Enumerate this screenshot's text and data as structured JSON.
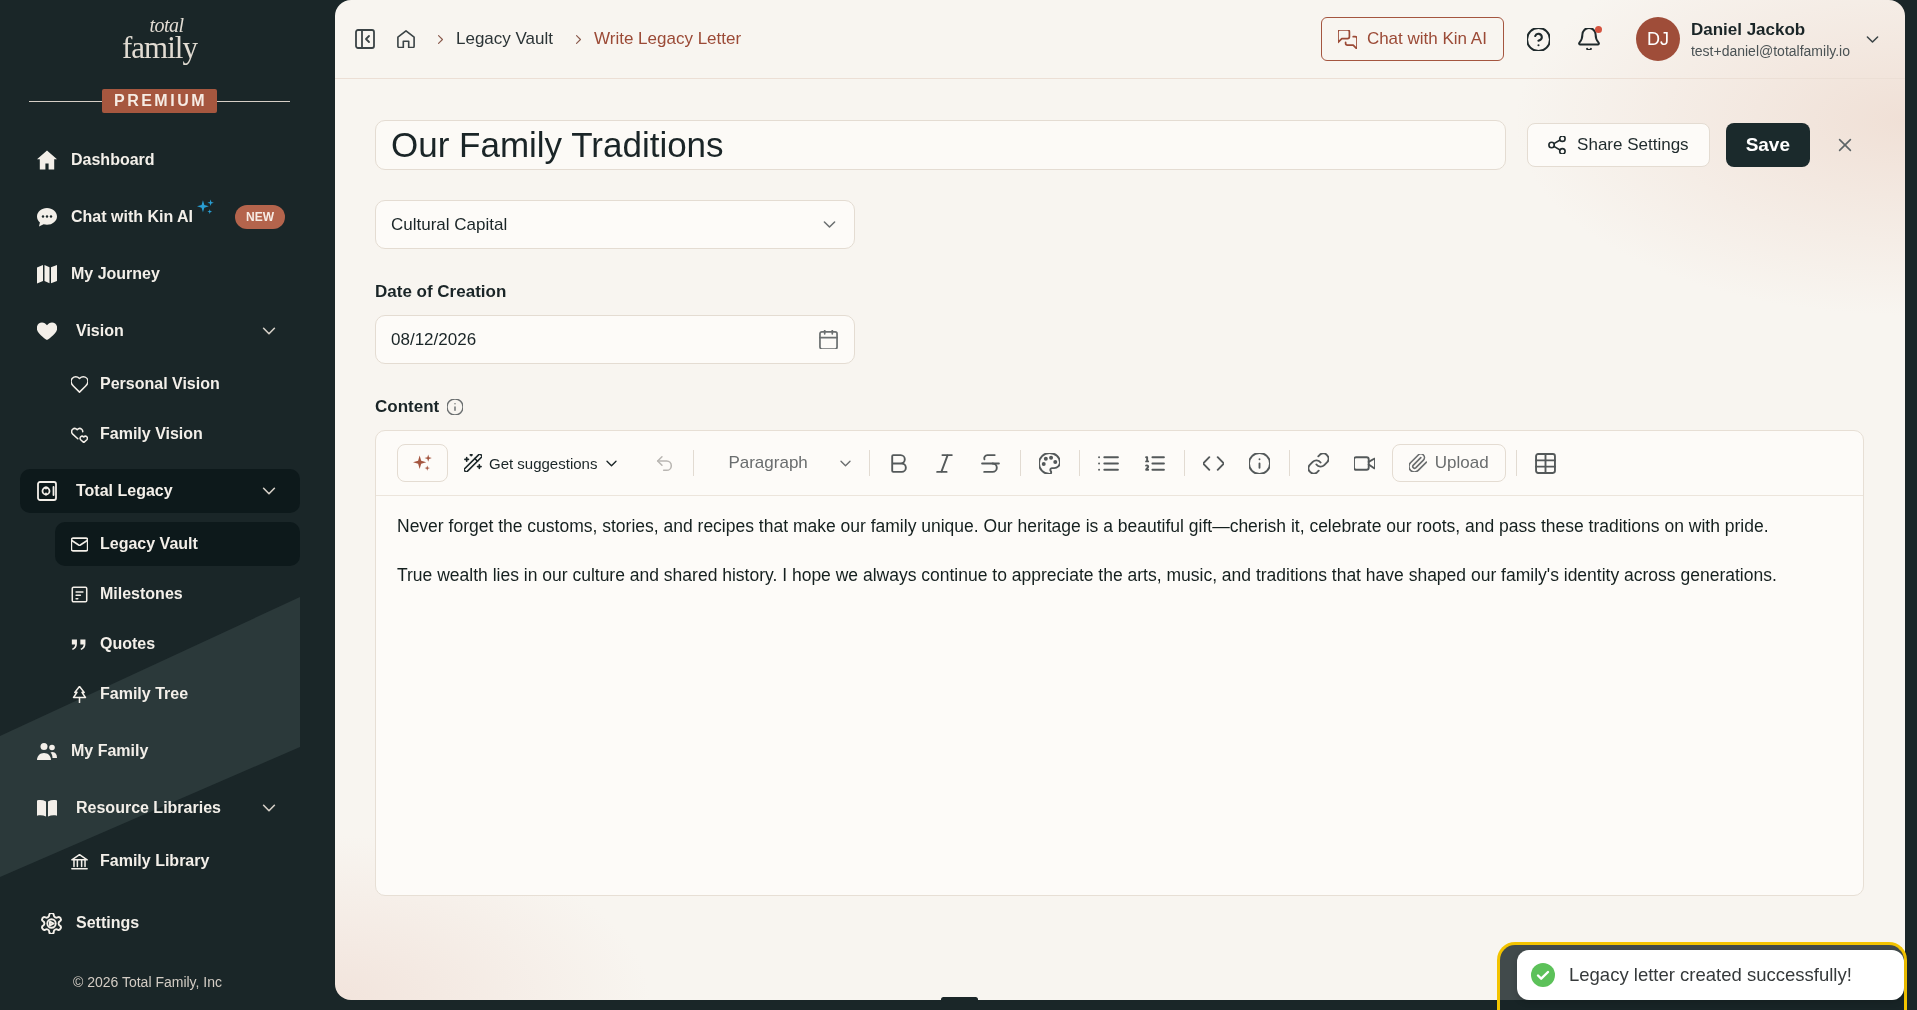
{
  "sidebar": {
    "logo": {
      "top_word": "total",
      "bottom_word": "family"
    },
    "plan_badge": "PREMIUM",
    "nav": [
      {
        "label": "Dashboard",
        "selected": false
      },
      {
        "label": "Chat with Kin AI",
        "badge": "NEW",
        "selected": false
      },
      {
        "label": "My Journey",
        "selected": false
      },
      {
        "label": "Vision",
        "selected": false,
        "expanded": true,
        "children": [
          {
            "label": "Personal Vision",
            "selected": false
          },
          {
            "label": "Family Vision",
            "selected": false
          }
        ]
      },
      {
        "label": "Total Legacy",
        "selected": true,
        "expanded": true,
        "children": [
          {
            "label": "Legacy Vault",
            "selected": true
          },
          {
            "label": "Milestones",
            "selected": false
          },
          {
            "label": "Quotes",
            "selected": false
          },
          {
            "label": "Family Tree",
            "selected": false
          }
        ]
      },
      {
        "label": "My Family",
        "selected": false
      },
      {
        "label": "Resource Libraries",
        "selected": false,
        "expanded": true,
        "children": [
          {
            "label": "Family Library",
            "selected": false
          }
        ]
      }
    ],
    "settings": {
      "label": "Settings"
    },
    "copyright": "© 2026 Total Family, Inc"
  },
  "topbar": {
    "breadcrumbs": [
      {
        "label": "Legacy Vault",
        "selected": false
      },
      {
        "label": "Write Legacy Letter",
        "selected": true
      }
    ],
    "chat_button": "Chat with Kin AI",
    "notifications": {
      "unread": true
    },
    "user": {
      "initials": "DJ",
      "name": "Daniel Jackob",
      "email": "test+daniel@totalfamily.io"
    }
  },
  "letter": {
    "title": "Our Family Traditions",
    "share_button": "Share Settings",
    "save_button": "Save",
    "category": {
      "value": "Cultural Capital"
    },
    "date": {
      "label": "Date of Creation",
      "value": "08/12/2026"
    },
    "content": {
      "label": "Content",
      "toolbar": {
        "suggestions": "Get suggestions",
        "undo": {
          "disabled": true
        },
        "block_style": "Paragraph",
        "upload": "Upload"
      },
      "paragraphs": [
        "Never forget the customs, stories, and recipes that make our family unique. Our heritage is a beautiful gift—cherish it, celebrate our roots, and pass these traditions on with pride.",
        "True wealth lies in our culture and shared history. I hope we always continue to appreciate the arts, music, and traditions that have shaped our family's identity across generations."
      ]
    }
  },
  "toast": {
    "message": "Legacy letter created successfully!"
  }
}
